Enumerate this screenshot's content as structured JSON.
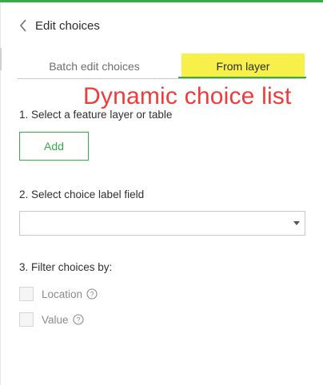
{
  "header": {
    "title": "Edit choices",
    "back_icon": "chevron-left-icon"
  },
  "tabs": [
    {
      "label": "Batch edit choices",
      "active": false
    },
    {
      "label": "From layer",
      "active": true,
      "highlight_color": "#f7f04a"
    }
  ],
  "annotation": {
    "text": "Dynamic choice list",
    "color": "#ee3b3b"
  },
  "steps": {
    "step1": {
      "label": "1. Select a feature layer or table",
      "button_label": "Add"
    },
    "step2": {
      "label": "2. Select choice label field",
      "select_value": ""
    },
    "step3": {
      "label": "3. Filter choices by:",
      "options": [
        {
          "label": "Location",
          "checked": false,
          "help_icon": "question-circle-icon"
        },
        {
          "label": "Value",
          "checked": false,
          "help_icon": "question-circle-icon"
        }
      ]
    }
  },
  "colors": {
    "accent": "#35ac46",
    "annotation": "#ee3b3b",
    "tab_highlight": "#f7f04a"
  }
}
